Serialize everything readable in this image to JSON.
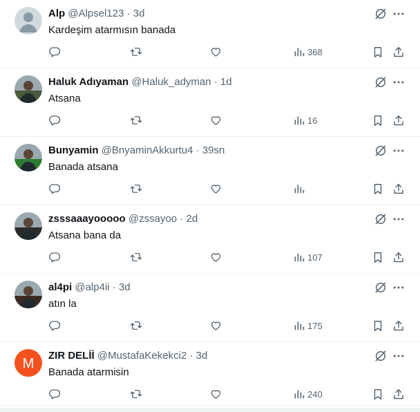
{
  "tweets": [
    {
      "name": "Alp",
      "handle": "@Alpsel123",
      "time": "3d",
      "text": "Kardeşim atarmısın banada",
      "views": "368",
      "avatar": "default",
      "avatar_color": "#cfd9de"
    },
    {
      "name": "Haluk Adıyaman",
      "handle": "@Haluk_adyman",
      "time": "1d",
      "text": "Atsana",
      "views": "16",
      "avatar": "photo",
      "avatar_color": "#4a5a3a"
    },
    {
      "name": "Bunyamin",
      "handle": "@BnyaminAkkurtu4",
      "time": "39sn",
      "text": "Banada atsana",
      "views": "",
      "avatar": "photo",
      "avatar_color": "#2e7d32"
    },
    {
      "name": "zsssaaayooooo",
      "handle": "@zssayoo",
      "time": "2d",
      "text": "Atsana bana da",
      "views": "107",
      "avatar": "photo",
      "avatar_color": "#2b2b2b"
    },
    {
      "name": "al4pi",
      "handle": "@alp4ii",
      "time": "3d",
      "text": "atın la",
      "views": "175",
      "avatar": "photo",
      "avatar_color": "#3a2a22"
    },
    {
      "name": "ZIR DELİİ",
      "handle": "@MustafaKekekci2",
      "time": "3d",
      "text": "Banada atarmisin",
      "views": "240",
      "avatar": "letter",
      "avatar_letter": "M",
      "avatar_color": "#f4511e"
    }
  ],
  "separator": "·",
  "icons": {
    "reply": "reply-icon",
    "retweet": "retweet-icon",
    "like": "like-icon",
    "views": "views-icon",
    "bookmark": "bookmark-icon",
    "share": "share-icon",
    "grok": "grok-icon",
    "more": "more-icon"
  },
  "colors": {
    "text": "#0f1419",
    "secondary": "#536471",
    "divider": "#eff3f4"
  }
}
